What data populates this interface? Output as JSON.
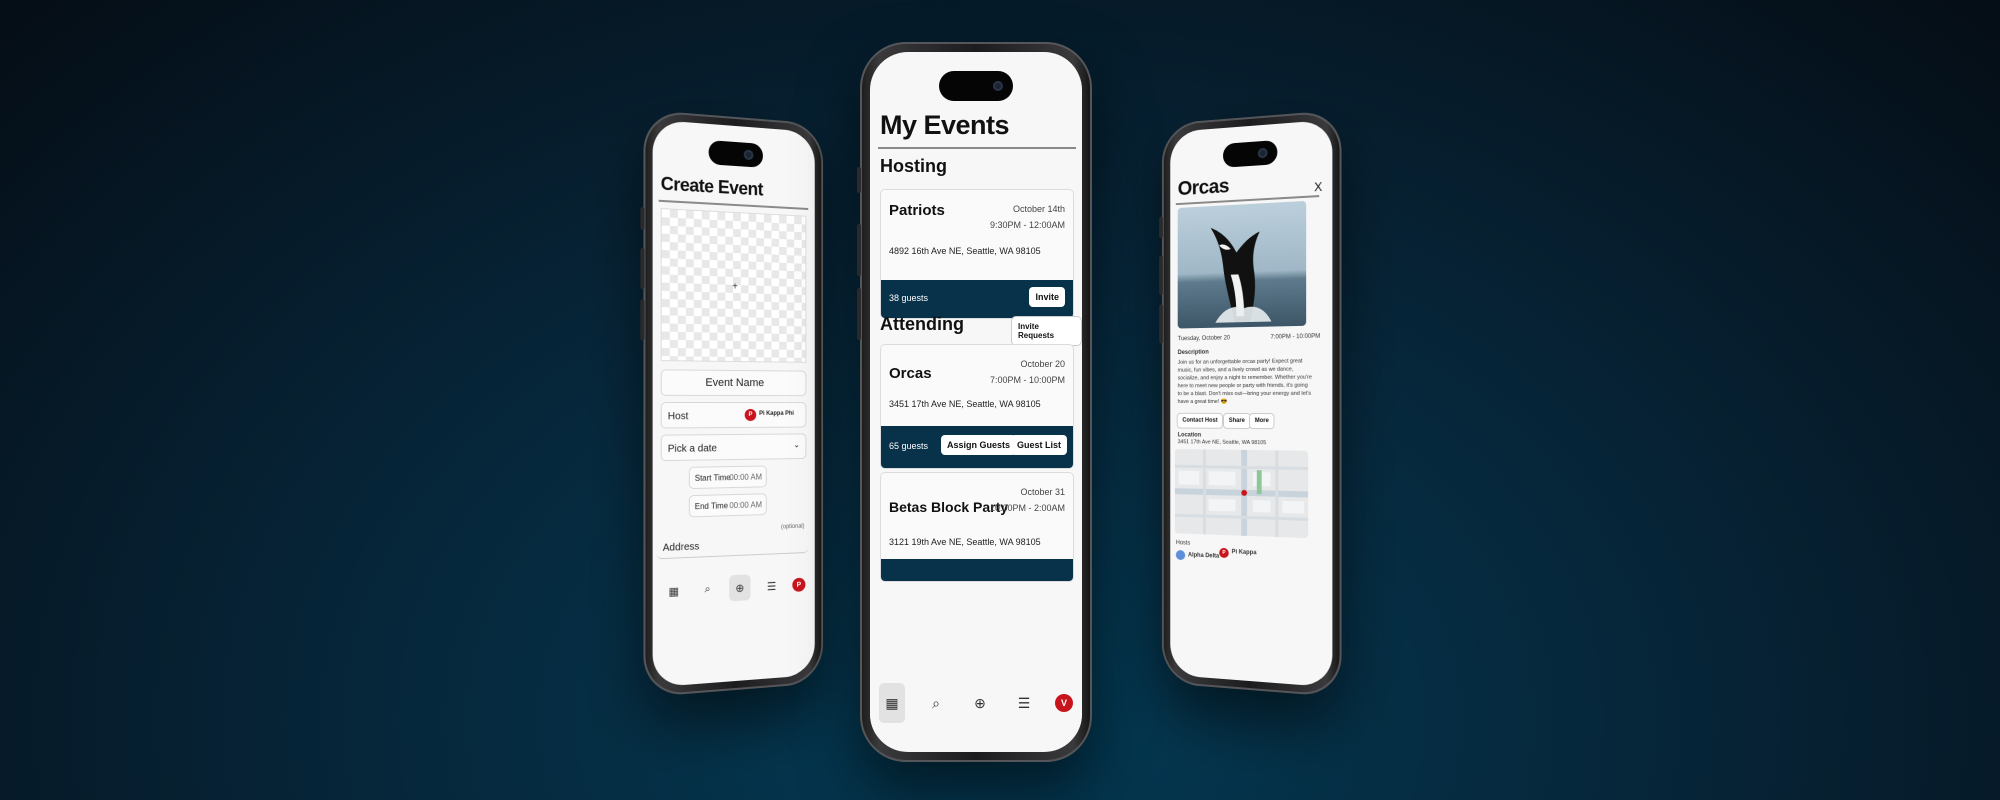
{
  "create_event": {
    "title": "Create Event",
    "upload_plus": "+",
    "event_name_placeholder": "Event Name",
    "host_label": "Host",
    "host_value": "Pi Kappa Phi",
    "host_avatar": "P",
    "date_placeholder": "Pick a date",
    "start_time_label": "Start Time",
    "start_time_value": "00:00 AM",
    "end_time_label": "End Time",
    "end_time_value": "00:00 AM",
    "optional_label": "(optional)",
    "address_placeholder": "Address",
    "nav_avatar": "P"
  },
  "my_events": {
    "title": "My Events",
    "hosting_title": "Hosting",
    "attending_title": "Attending",
    "invite_requests_label": "Invite Requests",
    "hosting": [
      {
        "name": "Patriots",
        "date": "October 14th",
        "time": "9:30PM - 12:00AM",
        "address": "4892 16th Ave NE, Seattle, WA 98105",
        "guests": "38 guests",
        "invite_label": "Invite"
      }
    ],
    "attending": [
      {
        "name": "Orcas",
        "date": "October 20",
        "time": "7:00PM - 10:00PM",
        "address": "3451 17th Ave NE, Seattle, WA 98105",
        "guests": "65 guests",
        "assign_label": "Assign Guests",
        "list_label": "Guest List"
      },
      {
        "name": "Betas Block Party",
        "date": "October 31",
        "time": "10:00PM - 2:00AM",
        "address": "3121 19th Ave NE, Seattle, WA 98105"
      }
    ],
    "nav_avatar": "V"
  },
  "event_detail": {
    "title": "Orcas",
    "close": "X",
    "date": "Tuesday, October 20",
    "time": "7:00PM - 10:00PM",
    "description_label": "Description",
    "description": "Join us for an unforgettable orcas party! Expect great music, fun vibes, and a lively crowd as we dance, socialize, and enjoy a night to remember. Whether you're here to meet new people or party with friends, it's going to be a blast. Don't miss out—bring your energy and let's have a great time! 😎",
    "contact_host_label": "Contact Host",
    "share_label": "Share",
    "more_label": "More",
    "location_label": "Location",
    "location_address": "3451 17th Ave NE, Seattle, WA 98105",
    "hosts_label": "Hosts",
    "hosts": [
      "Alpha Delta",
      "Pi Kappa"
    ],
    "host_avatar": "P"
  },
  "colors": {
    "navy": "#08314a",
    "accent_red": "#c8151d",
    "screen_bg": "#f7f7f7"
  }
}
